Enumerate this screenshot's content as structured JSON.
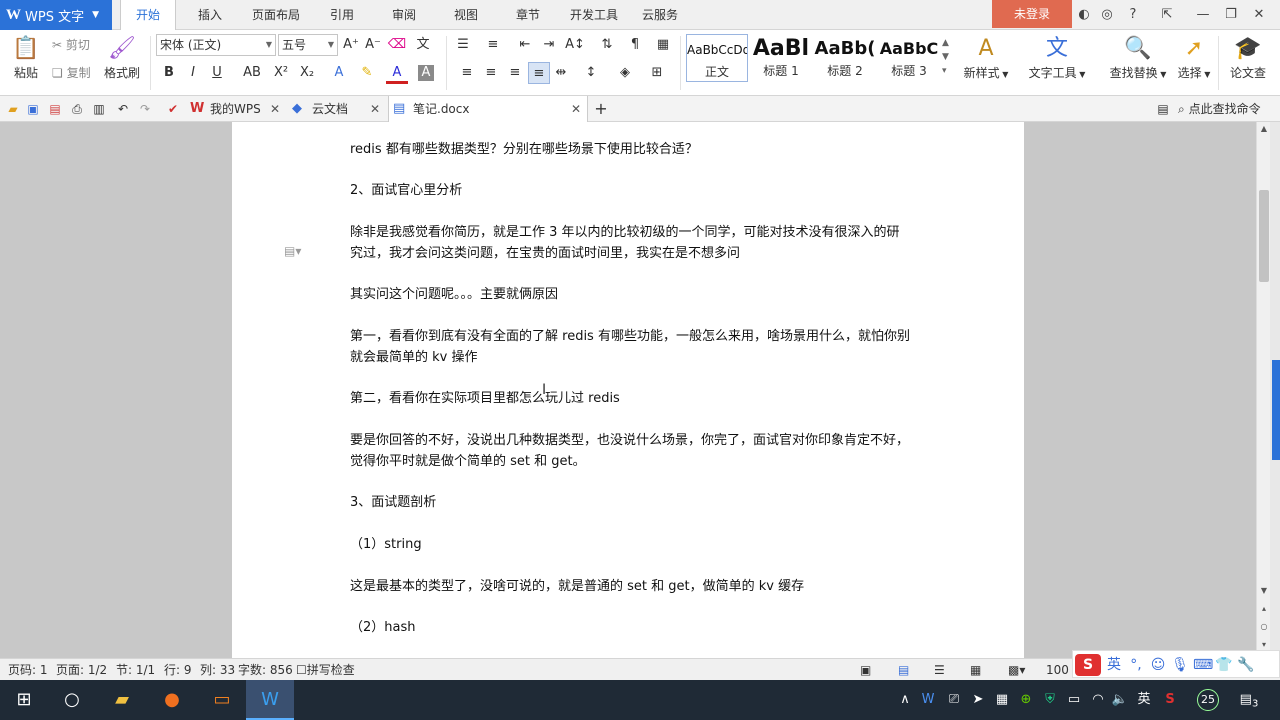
{
  "app": {
    "logo": "W",
    "name": "WPS 文字"
  },
  "menu": {
    "tabs": [
      "开始",
      "插入",
      "页面布局",
      "引用",
      "审阅",
      "视图",
      "章节",
      "开发工具",
      "云服务"
    ],
    "active_tab": "开始",
    "login": "未登录"
  },
  "ribbon": {
    "paste": "粘贴",
    "cut": "剪切",
    "copy": "复制",
    "format_painter": "格式刷",
    "font_name": "宋体 (正文)",
    "font_size": "五号",
    "styles": [
      {
        "sample": "AaBbCcDd",
        "name": "正文"
      },
      {
        "sample": "AaBl",
        "name": "标题 1"
      },
      {
        "sample": "AaBb(",
        "name": "标题 2"
      },
      {
        "sample": "AaBbC",
        "name": "标题 3"
      }
    ],
    "new_style": "新样式",
    "text_tools": "文字工具",
    "find_replace": "查找替换",
    "select": "选择",
    "thesis": "论文查"
  },
  "doc_tabs": [
    {
      "label": "我的WPS",
      "icon": "wps-icon"
    },
    {
      "label": "云文档",
      "icon": "cloud-box-icon"
    },
    {
      "label": "笔记.docx",
      "icon": "doc-icon"
    }
  ],
  "search_command": "点此查找命令",
  "document": {
    "paragraphs": [
      "redis 都有哪些数据类型？分别在哪些场景下使用比较合适？",
      "2、面试官心里分析",
      "除非是我感觉看你简历，就是工作 3 年以内的比较初级的一个同学，可能对技术没有很深入的研究过，我才会问这类问题，在宝贵的面试时间里，我实在是不想多问",
      "其实问这个问题呢。。。主要就俩原因",
      "第一，看看你到底有没有全面的了解 redis 有哪些功能，一般怎么来用，啥场景用什么，就怕你别就会最简单的 kv 操作",
      "第二，看看你在实际项目里都怎么玩儿过 redis",
      "要是你回答的不好，没说出几种数据类型，也没说什么场景，你完了，面试官对你印象肯定不好，觉得你平时就是做个简单的 set 和 get。",
      "3、面试题剖析",
      "（1）string",
      "这是最基本的类型了，没啥可说的，就是普通的 set 和 get，做简单的 kv 缓存",
      "（2）hash"
    ]
  },
  "status": {
    "page_num": "页码: 1",
    "page": "页面: 1/2",
    "section": "节: 1/1",
    "row": "行: 9",
    "col": "列: 33",
    "word_count": "字数: 856",
    "spell_check": "拼写检查",
    "zoom": "100 %"
  },
  "ime": {
    "lang": "英"
  },
  "taskbar": {
    "tray_lang": "英",
    "notification_count": "3",
    "badge": "25"
  },
  "colors": {
    "accent": "#2b72d8",
    "login": "#e06a50",
    "taskbar": "#1f2a36"
  }
}
